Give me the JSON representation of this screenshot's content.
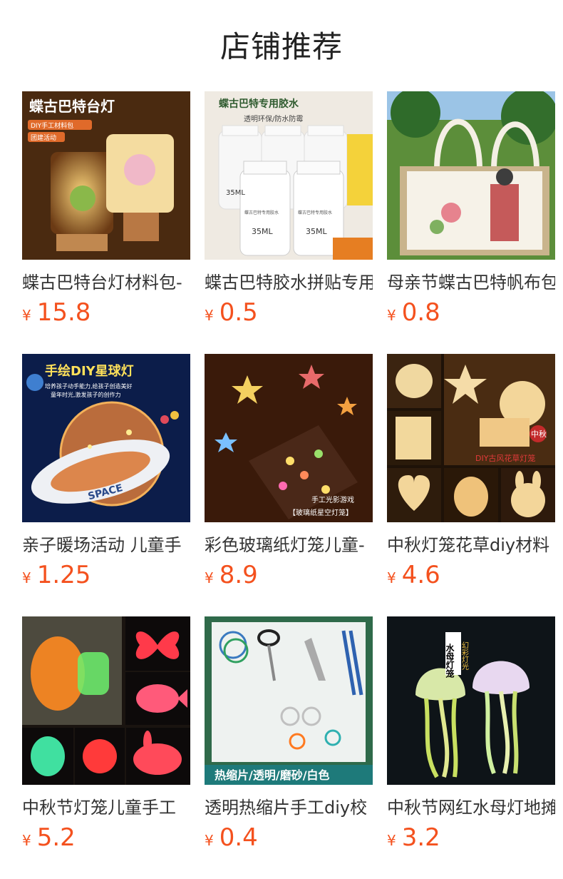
{
  "header": {
    "title": "店铺推荐"
  },
  "products": [
    {
      "name": "蝶古巴特台灯材料包-",
      "currency": "¥",
      "price": "15.8",
      "image_text": [
        "蝶古巴特台灯",
        "DIY手工材料包",
        "团建活动"
      ]
    },
    {
      "name": "蝶古巴特胶水拼贴专用",
      "currency": "¥",
      "price": "0.5",
      "image_text": [
        "蝶古巴特专用胶水",
        "透明环保/防水防霉",
        "35ML",
        "35ML",
        "35ML",
        "蝶古巴特专用胶水",
        "蝶古巴特专用胶水"
      ]
    },
    {
      "name": "母亲节蝶古巴特帆布包",
      "currency": "¥",
      "price": "0.8",
      "image_text": []
    },
    {
      "name": "亲子暖场活动 儿童手",
      "currency": "¥",
      "price": "1.25",
      "image_text": [
        "手绘DIY星球灯",
        "培养孩子动手能力,给孩子创造美好",
        "童年时光,激发孩子的创作力",
        "SPACE"
      ]
    },
    {
      "name": "彩色玻璃纸灯笼儿童-",
      "currency": "¥",
      "price": "8.9",
      "image_text": [
        "手工光影游戏",
        "【玻璃纸星空灯笼】"
      ]
    },
    {
      "name": "中秋灯笼花草diy材料",
      "currency": "¥",
      "price": "4.6",
      "image_text": [
        "中秋",
        "DIY古风花草灯笼"
      ]
    },
    {
      "name": "中秋节灯笼儿童手工",
      "currency": "¥",
      "price": "5.2",
      "image_text": []
    },
    {
      "name": "透明热缩片手工diy校",
      "currency": "¥",
      "price": "0.4",
      "image_text": [
        "热缩片/透明/磨砂/白色"
      ]
    },
    {
      "name": "中秋节网红水母灯地摊",
      "currency": "¥",
      "price": "3.2",
      "image_text": [
        "水母灯笼",
        "幻彩灯光"
      ]
    }
  ]
}
